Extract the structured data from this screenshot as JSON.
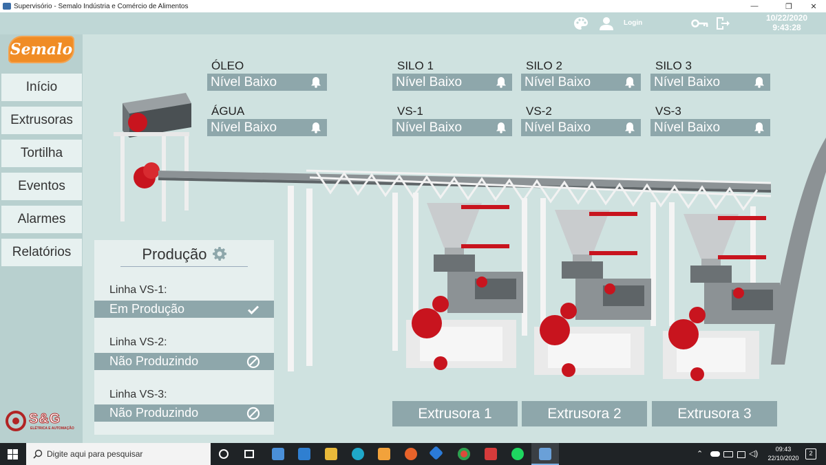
{
  "window": {
    "title": "Supervisório - Semalo Indústria e Comércio de Alimentos",
    "min": "—",
    "max": "❐",
    "close": "✕"
  },
  "header": {
    "login_label": "Login",
    "date": "10/22/2020",
    "time": "9:43:28"
  },
  "logo": {
    "text": "Semalo"
  },
  "sidebar": {
    "items": [
      {
        "label": "Início"
      },
      {
        "label": "Extrusoras"
      },
      {
        "label": "Tortilha"
      },
      {
        "label": "Eventos"
      },
      {
        "label": "Alarmes"
      },
      {
        "label": "Relatórios"
      }
    ]
  },
  "company_logo": {
    "name": "S&G",
    "sub": "ELÉTRICA E AUTOMAÇÃO"
  },
  "levels": [
    {
      "label": "ÓLEO",
      "status": "Nível Baixo"
    },
    {
      "label": "ÁGUA",
      "status": "Nível Baixo"
    },
    {
      "label": "SILO 1",
      "status": "Nível Baixo"
    },
    {
      "label": "SILO 2",
      "status": "Nível Baixo"
    },
    {
      "label": "SILO 3",
      "status": "Nível Baixo"
    },
    {
      "label": "VS-1",
      "status": "Nível Baixo"
    },
    {
      "label": "VS-2",
      "status": "Nível Baixo"
    },
    {
      "label": "VS-3",
      "status": "Nível Baixo"
    }
  ],
  "production": {
    "title": "Produção",
    "lines": [
      {
        "label": "Linha VS-1:",
        "status": "Em Produção",
        "state_icon": "check-icon"
      },
      {
        "label": "Linha VS-2:",
        "status": "Não Produzindo",
        "state_icon": "blocked-icon"
      },
      {
        "label": "Linha VS-3:",
        "status": "Não Produzindo",
        "state_icon": "blocked-icon"
      }
    ]
  },
  "extruders": [
    {
      "label": "Extrusora 1"
    },
    {
      "label": "Extrusora 2"
    },
    {
      "label": "Extrusora 3"
    }
  ],
  "taskbar": {
    "search_placeholder": "Digite aqui para pesquisar",
    "time": "09:43",
    "date": "22/10/2020",
    "notification_count": "2"
  },
  "colors": {
    "background": "#cfe2e0",
    "sidebar": "#b8d0cf",
    "indicator": "#8ea7ab",
    "machine_red": "#c8141e",
    "brand_orange": "#f08c25"
  }
}
